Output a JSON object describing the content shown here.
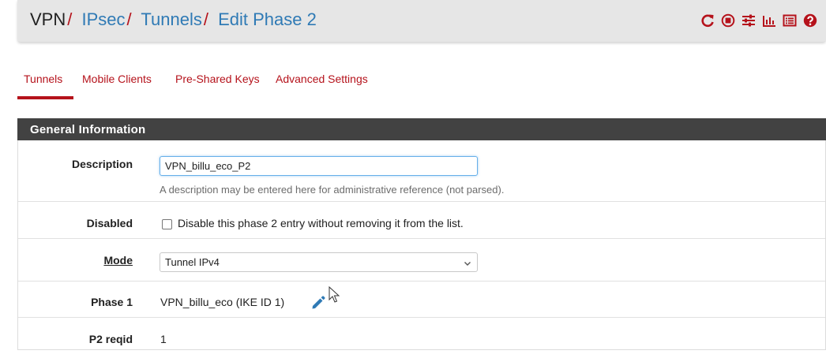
{
  "breadcrumb": {
    "items": [
      {
        "label": "VPN"
      },
      {
        "label": "IPsec"
      },
      {
        "label": "Tunnels"
      },
      {
        "label": "Edit Phase 2"
      }
    ],
    "separator": "/"
  },
  "toolbar": {
    "icons": [
      "reload-icon",
      "stop-icon",
      "settings-sliders-icon",
      "chart-icon",
      "log-list-icon",
      "help-icon"
    ]
  },
  "tabs": [
    {
      "label": "Tunnels",
      "active": true
    },
    {
      "label": "Mobile Clients",
      "active": false
    },
    {
      "label": "Pre-Shared Keys",
      "active": false
    },
    {
      "label": "Advanced Settings",
      "active": false
    }
  ],
  "panel": {
    "title": "General Information",
    "fields": {
      "description": {
        "label": "Description",
        "value": "VPN_billu_eco_P2",
        "help": "A description may be entered here for administrative reference (not parsed)."
      },
      "disabled": {
        "label": "Disabled",
        "checked": false,
        "checkbox_label": "Disable this phase 2 entry without removing it from the list."
      },
      "mode": {
        "label": "Mode",
        "selected": "Tunnel IPv4"
      },
      "phase1": {
        "label": "Phase 1",
        "value": "VPN_billu_eco (IKE ID 1)"
      },
      "p2reqid": {
        "label": "P2 reqid",
        "value": "1"
      }
    }
  },
  "colors": {
    "accent_red": "#b5121b",
    "link_blue": "#2f7ab5",
    "panel_header_bg": "#424242"
  }
}
